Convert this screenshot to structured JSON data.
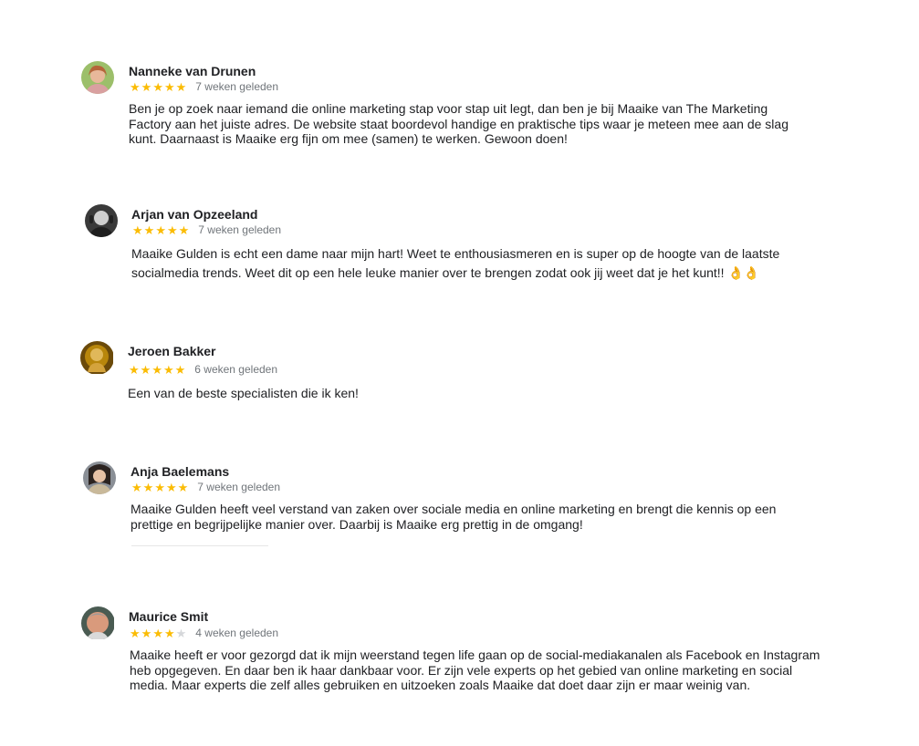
{
  "reviews": [
    {
      "name": "Nanneke van Drunen",
      "rating": 5,
      "time": "7 weken geleden",
      "text": "Ben je op zoek naar iemand die online marketing stap voor stap uit legt, dan ben je bij Maaike van The Marketing Factory aan het juiste adres. De website staat boordevol handige en praktische tips waar je meteen mee aan de slag kunt. Daarnaast is Maaike erg fijn om mee (samen) te werken. Gewoon doen!"
    },
    {
      "name": "Arjan van Opzeeland",
      "rating": 5,
      "time": "7 weken geleden",
      "text": "Maaike Gulden is echt een dame naar mijn hart! Weet te enthousiasmeren en is super op de hoogte van de laatste socialmedia trends. Weet dit op een hele leuke manier over te brengen zodat ook jij weet dat je het kunt!!",
      "emoji": "👌👌"
    },
    {
      "name": "Jeroen Bakker",
      "rating": 5,
      "time": "6 weken geleden",
      "text": "Een van de beste specialisten die ik ken!"
    },
    {
      "name": "Anja Baelemans",
      "rating": 5,
      "time": "7 weken geleden",
      "text": "Maaike Gulden heeft veel verstand van zaken over sociale media en online marketing en brengt die kennis op een prettige en begrijpelijke manier over. Daarbij is Maaike erg prettig in de omgang!"
    },
    {
      "name": "Maurice Smit",
      "rating": 4,
      "time": "4 weken geleden",
      "text": "Maaike heeft er voor gezorgd dat ik mijn weerstand tegen life gaan op de social-mediakanalen als Facebook en Instagram heb opgegeven. En daar ben ik haar dankbaar voor. Er zijn vele experts op het gebied van online marketing en social media. Maar experts die zelf alles gebruiken en uitzoeken zoals Maaike dat doet daar zijn er maar weinig van."
    }
  ]
}
